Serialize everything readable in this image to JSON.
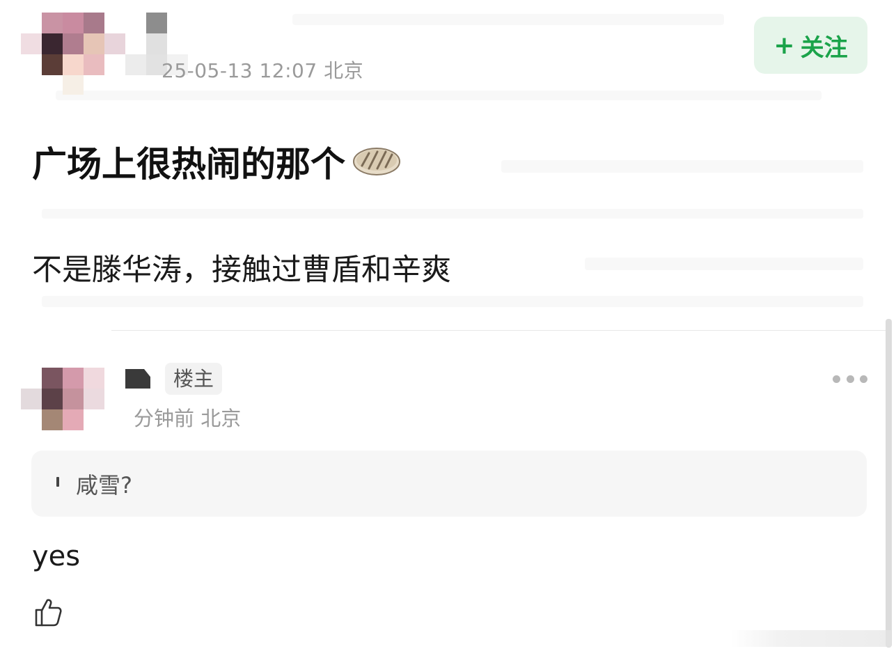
{
  "post": {
    "meta": "25-05-13 12:07 北京",
    "follow_label": "关注",
    "follow_plus": "+",
    "title": "广场上很热闹的那个",
    "title_emoji_icon": "bread-icon",
    "body": "不是滕华涛，接触过曹盾和辛爽"
  },
  "comment": {
    "op_badge": "楼主",
    "meta": "分钟前 北京",
    "quote": "咸雪?",
    "text": "yes",
    "more_icon": "more-dots-icon",
    "like_icon": "thumbs-up-icon"
  },
  "colors": {
    "accent_green": "#1ba34a",
    "follow_bg": "#e6f5ea",
    "muted_text": "#9a9a9a",
    "quote_bg": "#f6f6f6"
  }
}
